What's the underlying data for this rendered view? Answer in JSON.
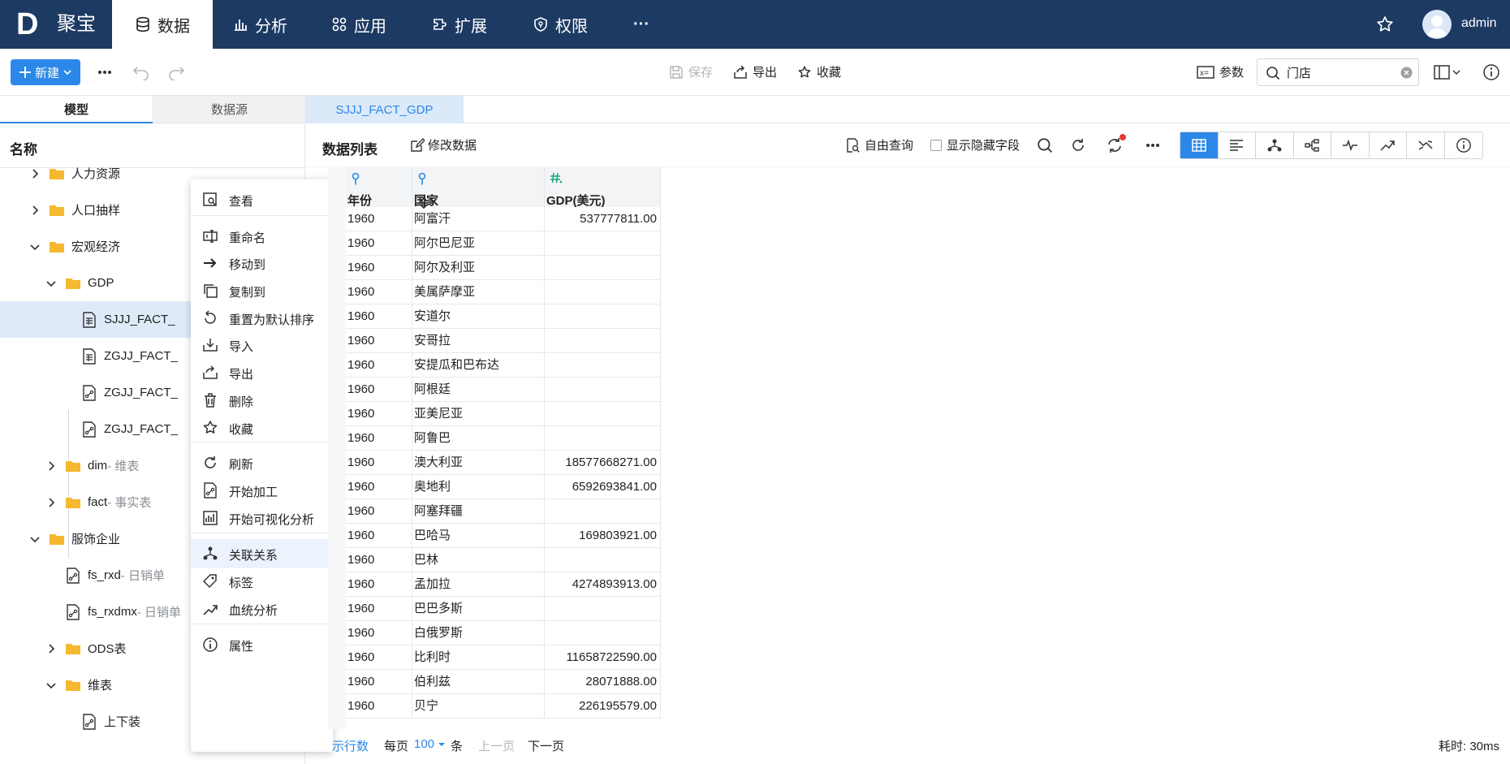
{
  "topbar": {
    "logo_letter": "D",
    "brand": "聚宝",
    "nav": [
      {
        "label": "数据",
        "icon": "database-icon"
      },
      {
        "label": "分析",
        "icon": "bar-chart-icon"
      },
      {
        "label": "应用",
        "icon": "apps-icon"
      },
      {
        "label": "扩展",
        "icon": "extension-icon"
      },
      {
        "label": "权限",
        "icon": "shield-icon"
      },
      {
        "label": "···",
        "icon": "more-icon"
      }
    ],
    "username": "admin"
  },
  "toolbar": {
    "new_label": "新建",
    "save_label": "保存",
    "export_label": "导出",
    "favorite_label": "收藏",
    "params_label": "参数",
    "search_value": "门店"
  },
  "left": {
    "tabs": [
      "模型",
      "数据源"
    ],
    "name_header": "名称",
    "tree": [
      {
        "label": "人力资源",
        "sub": "",
        "icon": "folder"
      },
      {
        "label": "人口抽样",
        "sub": "",
        "icon": "folder"
      },
      {
        "label": "宏观经济",
        "sub": "",
        "icon": "folder"
      },
      {
        "label": "GDP",
        "sub": "",
        "icon": "folder"
      },
      {
        "label": "SJJJ_FACT_",
        "sub": "",
        "icon": "table"
      },
      {
        "label": "ZGJJ_FACT_",
        "sub": "",
        "icon": "table"
      },
      {
        "label": "ZGJJ_FACT_",
        "sub": "",
        "icon": "etl"
      },
      {
        "label": "ZGJJ_FACT_",
        "sub": "",
        "icon": "etl"
      },
      {
        "label": "dim",
        "sub": " - 维表",
        "icon": "folder"
      },
      {
        "label": "fact",
        "sub": " - 事实表",
        "icon": "folder"
      },
      {
        "label": "服饰企业",
        "sub": "",
        "icon": "folder"
      },
      {
        "label": "fs_rxd",
        "sub": " - 日销单",
        "icon": "etl"
      },
      {
        "label": "fs_rxdmx",
        "sub": " - 日销单",
        "icon": "etl"
      },
      {
        "label": "ODS表",
        "sub": "",
        "icon": "folder"
      },
      {
        "label": "维表",
        "sub": "",
        "icon": "folder"
      },
      {
        "label": "上下装",
        "sub": "",
        "icon": "etl"
      }
    ]
  },
  "context_menu": [
    {
      "label": "查看",
      "icon": "view-icon"
    },
    {
      "label": "重命名",
      "icon": "rename-icon"
    },
    {
      "label": "移动到",
      "icon": "move-icon"
    },
    {
      "label": "复制到",
      "icon": "copy-icon"
    },
    {
      "label": "重置为默认排序",
      "icon": "reset-icon"
    },
    {
      "label": "导入",
      "icon": "import-icon"
    },
    {
      "label": "导出",
      "icon": "export-icon"
    },
    {
      "label": "删除",
      "icon": "trash-icon"
    },
    {
      "label": "收藏",
      "icon": "star-icon"
    },
    {
      "label": "刷新",
      "icon": "refresh-icon"
    },
    {
      "label": "开始加工",
      "icon": "etl-icon"
    },
    {
      "label": "开始可视化分析",
      "icon": "chart-icon"
    },
    {
      "label": "关联关系",
      "icon": "relation-icon"
    },
    {
      "label": "标签",
      "icon": "tag-icon"
    },
    {
      "label": "血统分析",
      "icon": "lineage-icon"
    },
    {
      "label": "属性",
      "icon": "info-icon"
    }
  ],
  "main": {
    "doc_tab": "SJJJ_FACT_GDP",
    "data_list_label": "数据列表",
    "edit_data_label": "修改数据",
    "free_query_label": "自由查询",
    "show_hidden_label": "显示隐藏字段",
    "columns": [
      "年份",
      "国家",
      "GDP(美元)"
    ],
    "rows": [
      [
        "1960",
        "阿富汗",
        "537777811.00"
      ],
      [
        "1960",
        "阿尔巴尼亚",
        ""
      ],
      [
        "1960",
        "阿尔及利亚",
        ""
      ],
      [
        "1960",
        "美属萨摩亚",
        ""
      ],
      [
        "1960",
        "安道尔",
        ""
      ],
      [
        "1960",
        "安哥拉",
        ""
      ],
      [
        "1960",
        "安提瓜和巴布达",
        ""
      ],
      [
        "1960",
        "阿根廷",
        ""
      ],
      [
        "1960",
        "亚美尼亚",
        ""
      ],
      [
        "1960",
        "阿鲁巴",
        ""
      ],
      [
        "1960",
        "澳大利亚",
        "18577668271.00"
      ],
      [
        "1960",
        "奥地利",
        "6592693841.00"
      ],
      [
        "1960",
        "阿塞拜疆",
        ""
      ],
      [
        "1960",
        "巴哈马",
        "169803921.00"
      ],
      [
        "1960",
        "巴林",
        ""
      ],
      [
        "1960",
        "孟加拉",
        "4274893913.00"
      ],
      [
        "1960",
        "巴巴多斯",
        ""
      ],
      [
        "1960",
        "白俄罗斯",
        ""
      ],
      [
        "1960",
        "比利时",
        "11658722590.00"
      ],
      [
        "1960",
        "伯利兹",
        "28071888.00"
      ],
      [
        "1960",
        "贝宁",
        "226195579.00"
      ]
    ],
    "pager": {
      "show_rows_label": "示行数",
      "per_page_label": "每页",
      "per_page_value": "100",
      "unit_label": "条",
      "prev_label": "上一页",
      "next_label": "下一页"
    },
    "timing": "耗时: 30ms"
  },
  "colors": {
    "topbar_bg": "#1d3a63",
    "primary": "#2b88e8",
    "folder": "#f5b82e",
    "selected_row": "#dfeaf8"
  }
}
